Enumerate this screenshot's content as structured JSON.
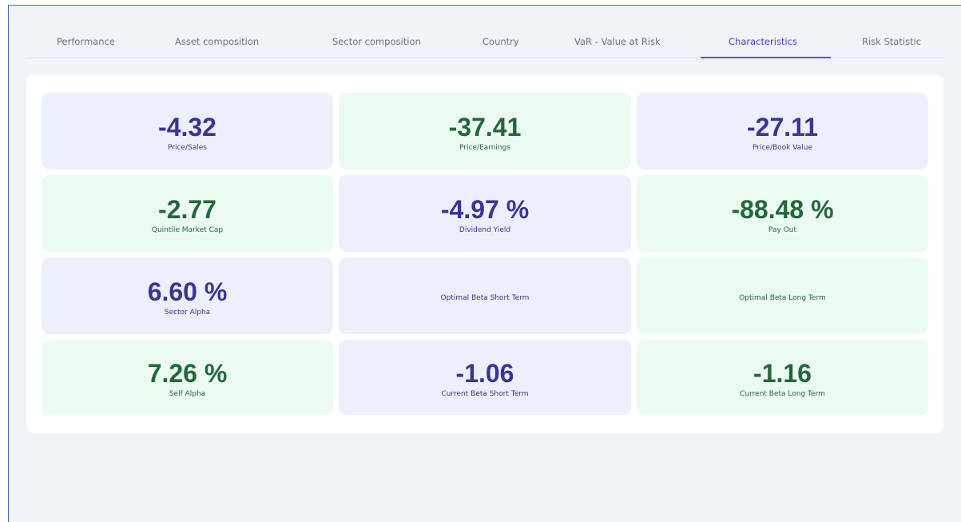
{
  "tabs": [
    {
      "label": "Performance"
    },
    {
      "label": "Asset composition"
    },
    {
      "label": "Sector composition"
    },
    {
      "label": "Country"
    },
    {
      "label": "VaR - Value at Risk"
    },
    {
      "label": "Characteristics"
    },
    {
      "label": "Risk Statistic"
    }
  ],
  "active_tab": "Characteristics",
  "metrics": [
    {
      "value": "-4.32",
      "label": "Price/Sales"
    },
    {
      "value": "-37.41",
      "label": "Price/Earnings"
    },
    {
      "value": "-27.11",
      "label": "Price/Book Value"
    },
    {
      "value": "-2.77",
      "label": "Quintile Market Cap"
    },
    {
      "value": "-4.97 %",
      "label": "Dividend Yield"
    },
    {
      "value": "-88.48 %",
      "label": "Pay Out"
    },
    {
      "value": "6.60 %",
      "label": "Sector Alpha"
    },
    {
      "value": "",
      "label": "Optimal Beta Short Term"
    },
    {
      "value": "",
      "label": "Optimal Beta Long Term"
    },
    {
      "value": "7.26 %",
      "label": "Self Alpha"
    },
    {
      "value": "-1.06",
      "label": "Current Beta Short Term"
    },
    {
      "value": "-1.16",
      "label": "Current Beta Long Term"
    }
  ],
  "colors": {
    "accent": "#5b54d6",
    "blue_card": "#ecf0fd",
    "green_card": "#ecfbf2",
    "blue_text": "#3a3396",
    "green_text": "#22683a"
  }
}
